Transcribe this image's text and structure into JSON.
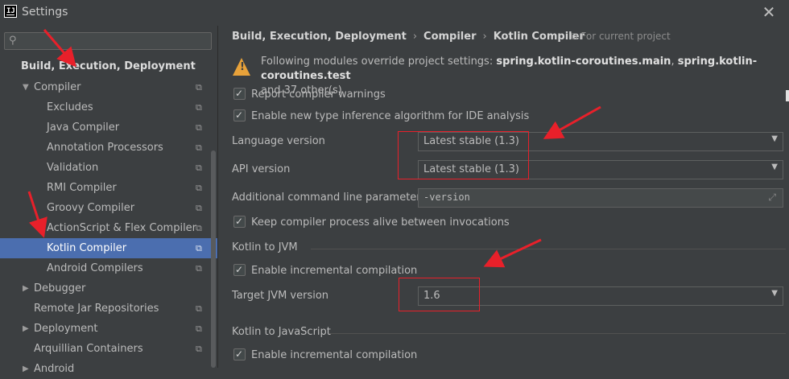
{
  "window": {
    "title": "Settings",
    "app_icon_text": "IJ"
  },
  "search": {
    "placeholder": "",
    "value": ""
  },
  "sidebar": {
    "items": [
      {
        "label": "Build, Execution, Deployment",
        "level": 0,
        "kind": "section"
      },
      {
        "label": "Compiler",
        "level": 1,
        "expanded": true,
        "copy": true
      },
      {
        "label": "Excludes",
        "level": 2,
        "copy": true
      },
      {
        "label": "Java Compiler",
        "level": 2,
        "copy": true
      },
      {
        "label": "Annotation Processors",
        "level": 2,
        "copy": true
      },
      {
        "label": "Validation",
        "level": 2,
        "copy": true
      },
      {
        "label": "RMI Compiler",
        "level": 2,
        "copy": true
      },
      {
        "label": "Groovy Compiler",
        "level": 2,
        "copy": true
      },
      {
        "label": "ActionScript & Flex Compiler",
        "level": 2,
        "copy": true
      },
      {
        "label": "Kotlin Compiler",
        "level": 2,
        "copy": true,
        "selected": true
      },
      {
        "label": "Android Compilers",
        "level": 2,
        "copy": true
      },
      {
        "label": "Debugger",
        "level": 1,
        "collapsed": true
      },
      {
        "label": "Remote Jar Repositories",
        "level": 1,
        "copy": true
      },
      {
        "label": "Deployment",
        "level": 1,
        "collapsed": true,
        "copy": true
      },
      {
        "label": "Arquillian Containers",
        "level": 1,
        "copy": true
      },
      {
        "label": "Android",
        "level": 1,
        "collapsed": true
      }
    ]
  },
  "breadcrumb": [
    "Build, Execution, Deployment",
    "Kotlin Compiler"
  ],
  "breadcrumb_compiler": "Compiler",
  "scope_label": "For current project",
  "warning": {
    "prefix": "Following modules override project settings: ",
    "module1": "spring.kotlin-coroutines.main",
    "comma": ", ",
    "module2": "spring.kotlin-coroutines.test",
    "suffix": "and 37 other(s)"
  },
  "options": {
    "report_warnings": "Report compiler warnings",
    "new_inference": "Enable new type inference algorithm for IDE analysis",
    "keep_alive": "Keep compiler process alive between invocations"
  },
  "language_version": {
    "label": "Language version",
    "value": "Latest stable (1.3)"
  },
  "api_version": {
    "label": "API version",
    "value": "Latest stable (1.3)"
  },
  "cmd_params": {
    "label": "Additional command line parameters:",
    "value": "-version"
  },
  "jvm": {
    "title": "Kotlin to JVM",
    "incremental": "Enable incremental compilation",
    "target_label": "Target JVM version",
    "target_value": "1.6"
  },
  "js": {
    "title": "Kotlin to JavaScript",
    "incremental": "Enable incremental compilation"
  },
  "annotation_color": "#e8202a",
  "selection_color": "#4b6eaf"
}
